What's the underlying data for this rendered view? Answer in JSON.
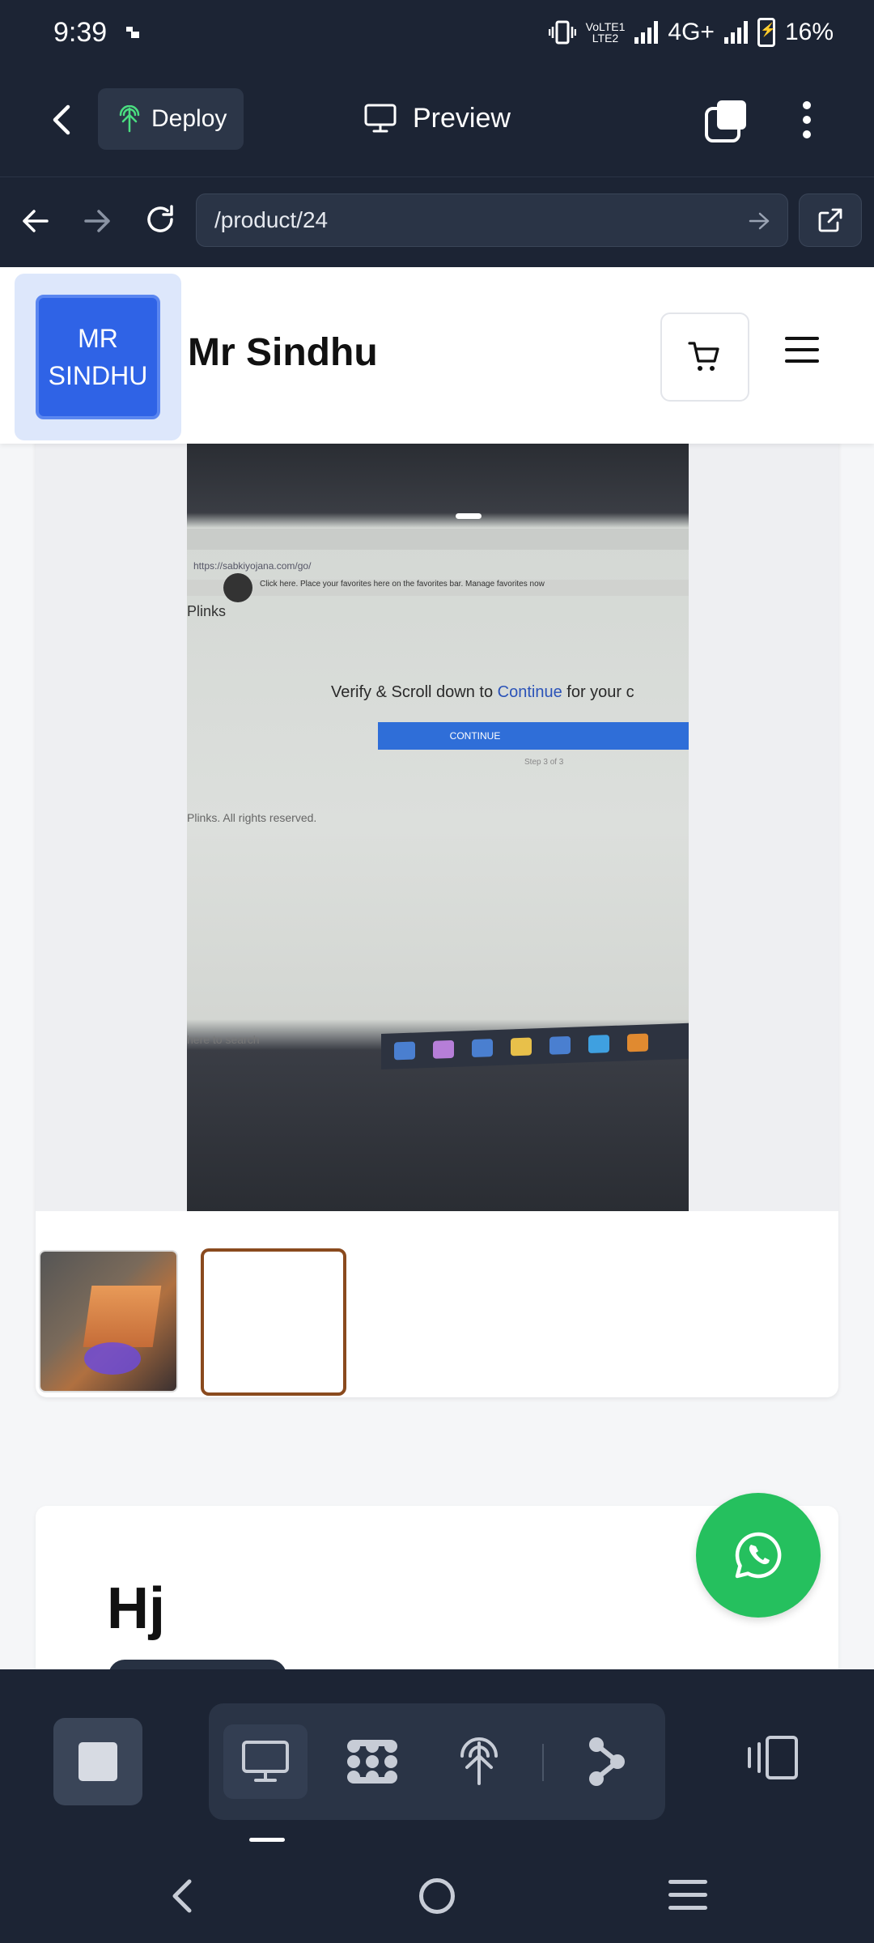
{
  "status_bar": {
    "time": "9:39",
    "network_label_top": "VoLTE1",
    "network_label_bottom": "LTE2",
    "network_type": "4G+",
    "battery": "16%"
  },
  "app_header": {
    "deploy_label": "Deploy",
    "preview_label": "Preview"
  },
  "url_bar": {
    "url": "/product/24"
  },
  "site": {
    "logo_line1": "MR",
    "logo_line2": "SINDHU",
    "name": "Mr Sindhu",
    "brand_color": "#2f63e6"
  },
  "product_photo": {
    "address_text": "https://sabkiyojana.com/go/",
    "favorites_text": "Click here. Place your favorites here on the favorites bar. Manage favorites now",
    "site_brand": "Plinks",
    "verify_text": "Verify & Scroll down to ",
    "verify_highlight": "Continue",
    "verify_suffix": " for your c",
    "continue_label": "CONTINUE",
    "step_text": "Step 3 of 3",
    "rights_text": "Plinks. All rights reserved.",
    "search_text": "here to search"
  },
  "product": {
    "title": "Hj"
  },
  "colors": {
    "whatsapp": "#25c05e",
    "thumb_selected_border": "#8a4a1e",
    "chrome_bg": "#1c2434"
  },
  "icons": {
    "back": "chevron-left-icon",
    "deploy": "deploy-antenna-icon",
    "preview": "monitor-icon",
    "tabs": "tabs-icon",
    "more": "more-vertical-icon",
    "cart": "cart-icon",
    "menu": "hamburger-icon",
    "whatsapp": "whatsapp-icon"
  }
}
